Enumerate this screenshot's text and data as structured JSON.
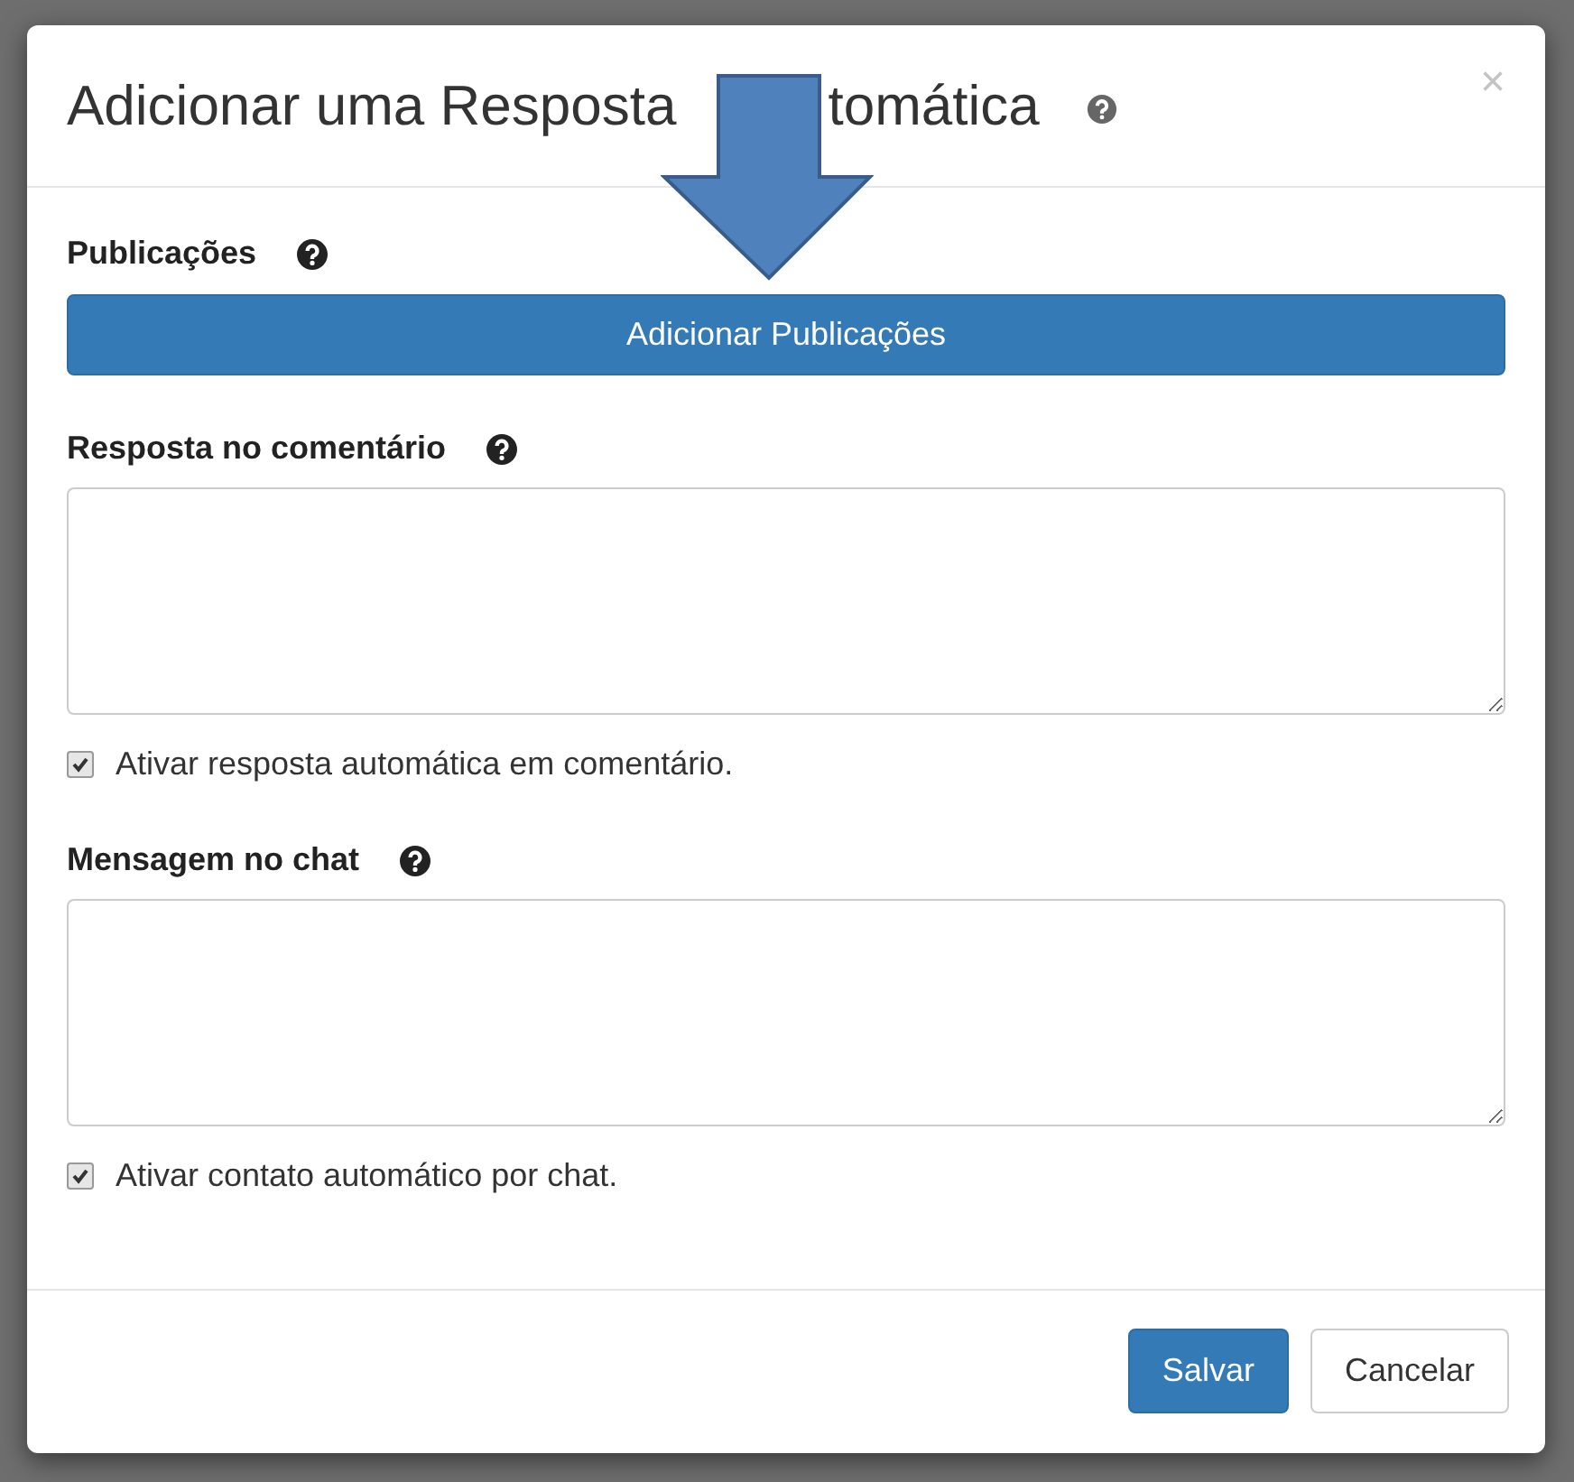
{
  "dialog": {
    "title_parts": [
      "Adicionar uma Resposta",
      "tomática"
    ],
    "close": "×",
    "sections": [
      {
        "kind": "button",
        "label": "Publicações",
        "button": "Adicionar Publicações"
      },
      {
        "kind": "textarea",
        "label": "Resposta no comentário",
        "checkbox": {
          "label": "Ativar resposta automática em comentário.",
          "checked": true
        }
      },
      {
        "kind": "textarea",
        "label": "Mensagem no chat",
        "checkbox": {
          "label": "Ativar contato automático por chat.",
          "checked": true
        }
      }
    ],
    "buttons": [
      {
        "label": "Salvar",
        "kind": "primary"
      },
      {
        "label": "Cancelar",
        "kind": "default"
      }
    ]
  }
}
